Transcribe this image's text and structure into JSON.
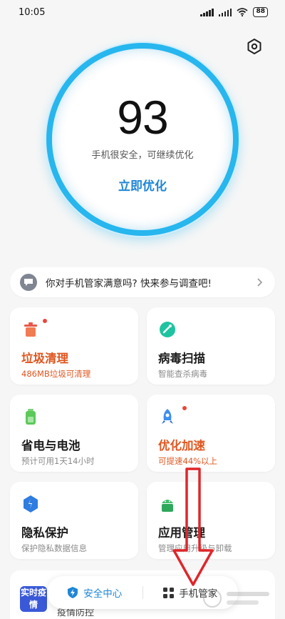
{
  "status_bar": {
    "time": "10:05",
    "battery": "88"
  },
  "score": {
    "value": "93",
    "description": "手机很安全，可继续优化",
    "action_label": "立即优化"
  },
  "survey": {
    "text": "你对手机管家满意吗? 快来参与调查吧!"
  },
  "cards": [
    {
      "title": "垃圾清理",
      "subtitle": "486MB垃圾可清理",
      "icon": "trash-icon",
      "highlight": true
    },
    {
      "title": "病毒扫描",
      "subtitle": "智能查杀病毒",
      "icon": "virus-scan-icon",
      "highlight": false
    },
    {
      "title": "省电与电池",
      "subtitle": "预计可用1天14小时",
      "icon": "battery-icon",
      "highlight": false
    },
    {
      "title": "优化加速",
      "subtitle": "可提速44%以上",
      "icon": "rocket-icon",
      "highlight": true
    },
    {
      "title": "隐私保护",
      "subtitle": "保护隐私数据信息",
      "icon": "privacy-shield-icon",
      "highlight": false
    },
    {
      "title": "应用管理",
      "subtitle": "管理应用升级与卸载",
      "icon": "android-app-icon",
      "highlight": false
    }
  ],
  "bottom_card": {
    "badge": "实时疫情",
    "text": "疫情防控"
  },
  "tabbar": {
    "tabs": [
      {
        "label": "安全中心",
        "icon": "shield-lightning-icon",
        "active": true
      },
      {
        "label": "手机管家",
        "icon": "grid-icon",
        "active": false
      }
    ]
  },
  "colors": {
    "ring": "#27b6ee",
    "accent": "#1f86d6",
    "warning": "#e0561f",
    "notify_dot": "#e9473c"
  }
}
